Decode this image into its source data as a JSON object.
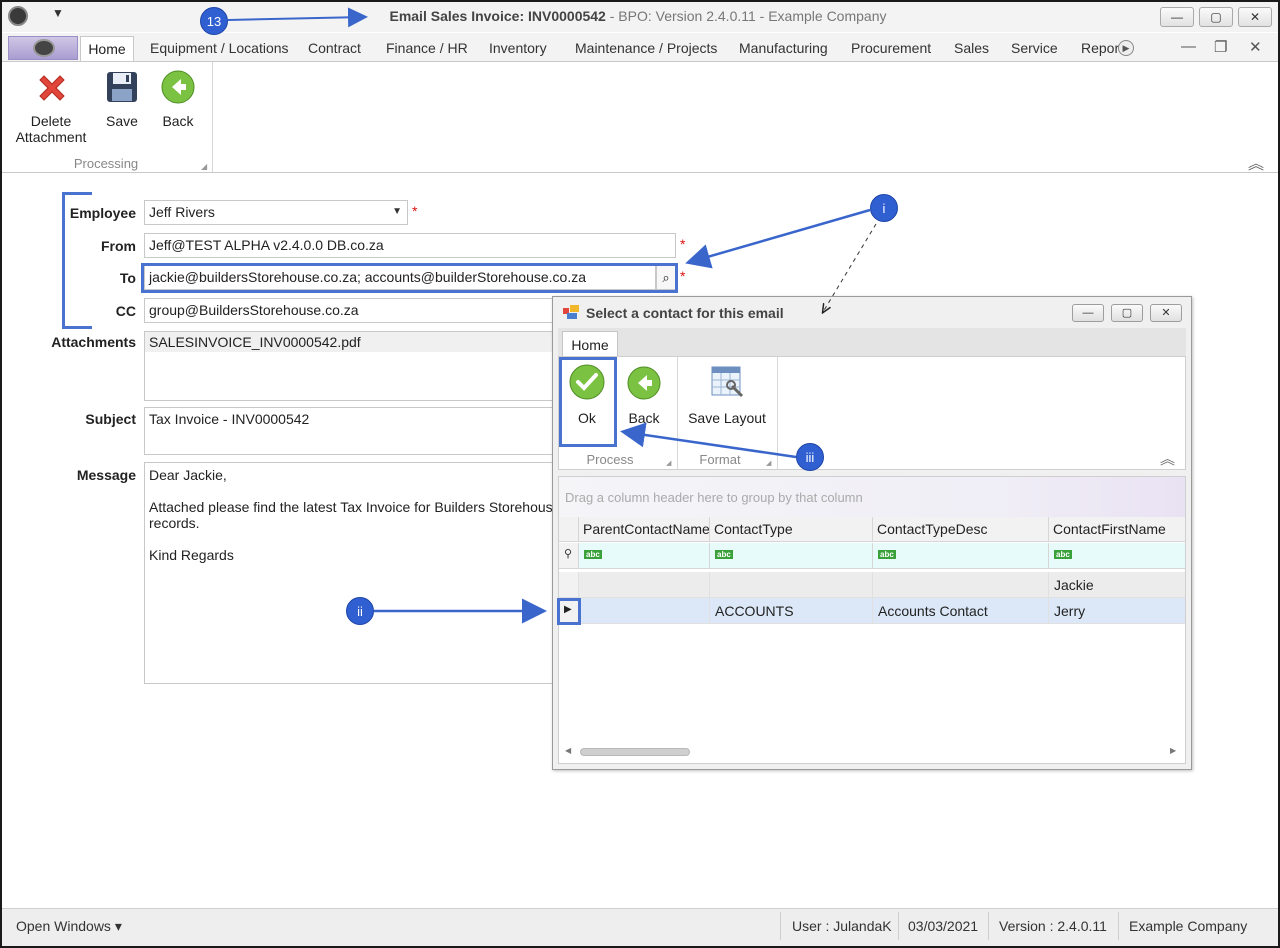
{
  "window": {
    "title_bold": "Email Sales Invoice: INV0000542",
    "title_rest": " - BPO: Version 2.4.0.11 - Example Company",
    "minimize": "—",
    "maximize": "▢",
    "close": "✕"
  },
  "menu": {
    "tabs": [
      "Home",
      "Equipment / Locations",
      "Contract",
      "Finance / HR",
      "Inventory",
      "Maintenance / Projects",
      "Manufacturing",
      "Procurement",
      "Sales",
      "Service",
      "Repor"
    ]
  },
  "ribbon": {
    "delete_label_1": "Delete",
    "delete_label_2": "Attachment",
    "save_label": "Save",
    "back_label": "Back",
    "group_label": "Processing"
  },
  "form": {
    "employee_label": "Employee",
    "employee_value": "Jeff Rivers",
    "from_label": "From",
    "from_value": "Jeff@TEST ALPHA v2.4.0.0 DB.co.za",
    "to_label": "To",
    "to_value": "jackie@buildersStorehouse.co.za; accounts@builderStorehouse.co.za",
    "cc_label": "CC",
    "cc_value": "group@BuildersStorehouse.co.za",
    "attachments_label": "Attachments",
    "attachments_value": "SALESINVOICE_INV0000542.pdf",
    "subject_label": "Subject",
    "subject_value": "Tax Invoice - INV0000542",
    "message_label": "Message",
    "message_lines": [
      "Dear Jackie,",
      "",
      "Attached please find the latest Tax Invoice for Builders Storehouse",
      "records.",
      "",
      "Kind Regards"
    ],
    "required_mark": "*"
  },
  "dialog": {
    "title": "Select a contact for this email",
    "tab": "Home",
    "ok_label": "Ok",
    "back_label": "Back",
    "save_layout_label": "Save Layout",
    "group_process": "Process",
    "group_format": "Format",
    "group_hint": "Drag a column header here to group by that column",
    "columns": [
      "ParentContactName",
      "ContactType",
      "ContactTypeDesc",
      "ContactFirstName"
    ],
    "filter_glyph": "abc",
    "rows": [
      [
        "",
        "",
        "",
        "Jackie"
      ],
      [
        "",
        "ACCOUNTS",
        "Accounts Contact",
        "Jerry"
      ]
    ]
  },
  "status": {
    "open_windows": "Open Windows ▾",
    "user": "User : JulandaK",
    "date": "03/03/2021",
    "version": "Version : 2.4.0.11",
    "company": "Example Company"
  },
  "annotations": {
    "step": "13",
    "i": "i",
    "ii": "ii",
    "iii": "iii"
  },
  "colors": {
    "annotation_blue": "#2f5fd0",
    "required_red": "#d11111",
    "selected_row": "#dce8f7"
  }
}
